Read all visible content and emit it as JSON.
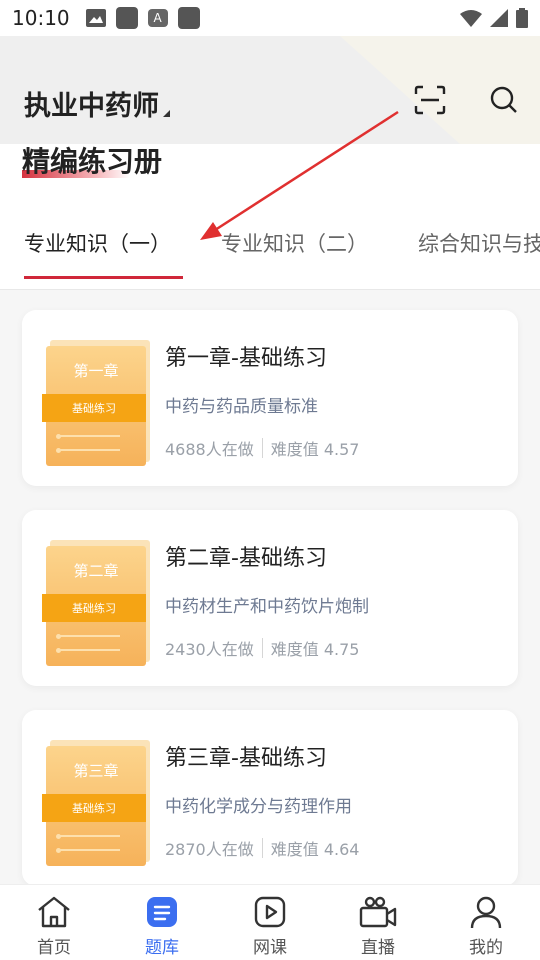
{
  "status_bar": {
    "time": "10:10",
    "icons_left": [
      "image-icon",
      "square-icon",
      "a-icon",
      "square-icon"
    ],
    "icons_right": [
      "wifi-icon",
      "signal-icon",
      "battery-icon"
    ]
  },
  "header": {
    "title": "执业中药师",
    "scan_icon": "scan-icon",
    "search_icon": "search-icon"
  },
  "book": {
    "title": "精编练习册"
  },
  "tabs": [
    {
      "label": "专业知识（一）",
      "active": true
    },
    {
      "label": "专业知识（二）",
      "active": false
    },
    {
      "label": "综合知识与技",
      "active": false
    }
  ],
  "chapters": [
    {
      "cover_chapter": "第一章",
      "cover_band": "基础练习",
      "title": "第一章-基础练习",
      "subtitle": "中药与药品质量标准",
      "people": "4688人在做",
      "difficulty": "难度值 4.57"
    },
    {
      "cover_chapter": "第二章",
      "cover_band": "基础练习",
      "title": "第二章-基础练习",
      "subtitle": "中药材生产和中药饮片炮制",
      "people": "2430人在做",
      "difficulty": "难度值 4.75"
    },
    {
      "cover_chapter": "第三章",
      "cover_band": "基础练习",
      "title": "第三章-基础练习",
      "subtitle": "中药化学成分与药理作用",
      "people": "2870人在做",
      "difficulty": "难度值 4.64"
    }
  ],
  "bottom_nav": [
    {
      "label": "首页",
      "icon": "home-icon",
      "active": false
    },
    {
      "label": "题库",
      "icon": "question-bank-icon",
      "active": true
    },
    {
      "label": "网课",
      "icon": "play-icon",
      "active": false
    },
    {
      "label": "直播",
      "icon": "camera-icon",
      "active": false
    },
    {
      "label": "我的",
      "icon": "user-icon",
      "active": false
    }
  ],
  "colors": {
    "accent_red": "#d0283a",
    "accent_blue": "#3b6ef0",
    "cover_orange": "#f5a414",
    "annotation_red": "#e03030"
  }
}
